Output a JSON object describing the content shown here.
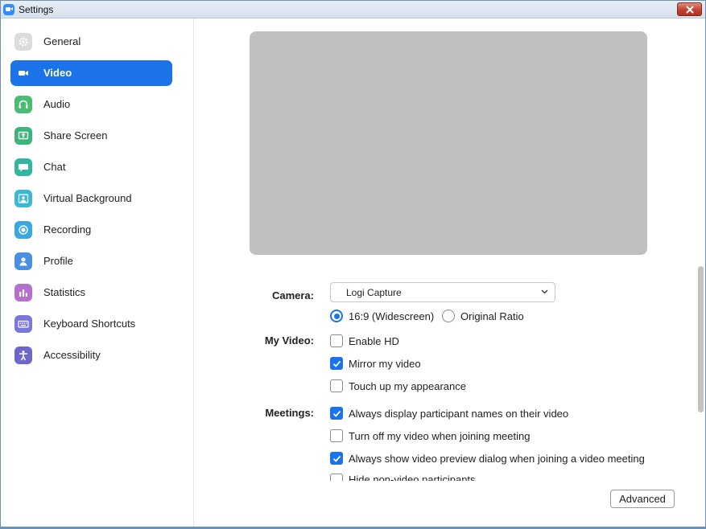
{
  "window": {
    "title": "Settings",
    "close_icon": "close-icon"
  },
  "sidebar": {
    "items": [
      {
        "label": "General",
        "icon": "gear-icon",
        "color": "#c8c8c8",
        "active": false
      },
      {
        "label": "Video",
        "icon": "video-camera-icon",
        "color": "#1a73e8",
        "active": true
      },
      {
        "label": "Audio",
        "icon": "headphones-icon",
        "color": "#4cbb73",
        "active": false
      },
      {
        "label": "Share Screen",
        "icon": "share-screen-icon",
        "color": "#3bb57a",
        "active": false
      },
      {
        "label": "Chat",
        "icon": "chat-bubble-icon",
        "color": "#33b5a0",
        "active": false
      },
      {
        "label": "Virtual Background",
        "icon": "person-frame-icon",
        "color": "#3cb7d4",
        "active": false
      },
      {
        "label": "Recording",
        "icon": "record-icon",
        "color": "#3aa8e0",
        "active": false
      },
      {
        "label": "Profile",
        "icon": "person-icon",
        "color": "#4a90e2",
        "active": false
      },
      {
        "label": "Statistics",
        "icon": "bar-chart-icon",
        "color": "#b56fcf",
        "active": false
      },
      {
        "label": "Keyboard Shortcuts",
        "icon": "keyboard-icon",
        "color": "#7c78d8",
        "active": false
      },
      {
        "label": "Accessibility",
        "icon": "accessibility-icon",
        "color": "#6f66c9",
        "active": false
      }
    ]
  },
  "video": {
    "camera_label": "Camera:",
    "camera_value": "Logi Capture",
    "ratio_options": [
      {
        "label": "16:9 (Widescreen)",
        "checked": true
      },
      {
        "label": "Original Ratio",
        "checked": false
      }
    ],
    "my_video_label": "My Video:",
    "my_video_options": [
      {
        "label": "Enable HD",
        "checked": false
      },
      {
        "label": "Mirror my video",
        "checked": true
      },
      {
        "label": "Touch up my appearance",
        "checked": false
      }
    ],
    "meetings_label": "Meetings:",
    "meetings_options": [
      {
        "label": "Always display participant names on their video",
        "checked": true
      },
      {
        "label": "Turn off my video when joining meeting",
        "checked": false
      },
      {
        "label": "Always show video preview dialog when joining a video meeting",
        "checked": true
      }
    ],
    "cut_off_option": {
      "label": "Hide non-video participants",
      "checked": false
    },
    "advanced_label": "Advanced"
  },
  "colors": {
    "accent": "#1a73e8",
    "preview_bg": "#c0c0c0"
  }
}
